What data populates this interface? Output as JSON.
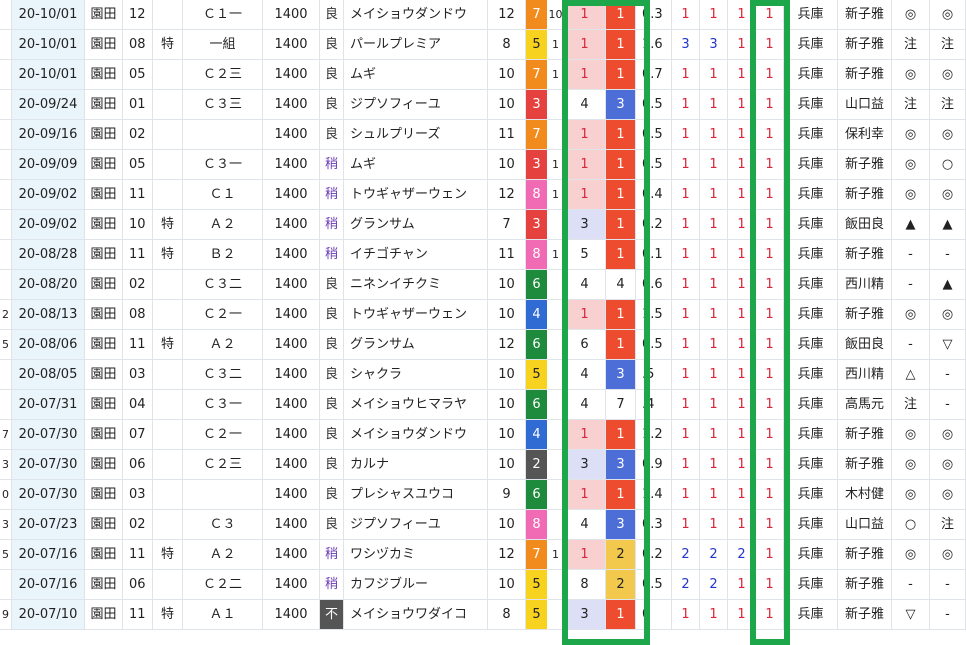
{
  "colors": {
    "frame_green": "#1ea64b",
    "rank_light_pink": "#f9d0d0",
    "rank_red": "#ee4c2f",
    "rank_blue": "#4c6ed6",
    "rank_lavender": "#dcdff5",
    "rank_gold": "#f2c94c",
    "text_red": "#d8263a",
    "text_blue": "#2336c8"
  },
  "gate_colors": {
    "1": "#ffffff",
    "2": "#555555",
    "3": "#e5423f",
    "4": "#2f6bd3",
    "5": "#f7d21e",
    "6": "#1d8a3c",
    "7": "#f28b1e",
    "8": "#f06bb4"
  },
  "rows": [
    {
      "date": "20-10/01",
      "track": "園田",
      "race": "12",
      "special": "",
      "cls": "Ｃ１一",
      "dist": "1400",
      "weather": "良",
      "weather_type": "norm",
      "horse": "メイショウダンドウ",
      "field": "12",
      "gate": "7",
      "h": "10",
      "p1": "1",
      "p2": "1",
      "t": "0.3",
      "c1": "1",
      "c2": "1",
      "c3": "1",
      "fin": "1",
      "loc": "兵庫",
      "jockey": "新子雅",
      "m1": "◎",
      "m2": "◎",
      "lead": ""
    },
    {
      "date": "20-10/01",
      "track": "園田",
      "race": "08",
      "special": "特",
      "cls": "一組",
      "dist": "1400",
      "weather": "良",
      "weather_type": "norm",
      "horse": "パールプレミア",
      "field": "8",
      "gate": "5",
      "h": "1",
      "p1": "1",
      "p2": "1",
      "t": "1.6",
      "c1": "3",
      "c2": "3",
      "c3": "1",
      "fin": "1",
      "loc": "兵庫",
      "jockey": "新子雅",
      "m1": "注",
      "m2": "注",
      "lead": ""
    },
    {
      "date": "20-10/01",
      "track": "園田",
      "race": "05",
      "special": "",
      "cls": "Ｃ２三",
      "dist": "1400",
      "weather": "良",
      "weather_type": "norm",
      "horse": "ムギ",
      "field": "10",
      "gate": "7",
      "h": "1",
      "p1": "1",
      "p2": "1",
      "t": "0.7",
      "c1": "1",
      "c2": "1",
      "c3": "1",
      "fin": "1",
      "loc": "兵庫",
      "jockey": "新子雅",
      "m1": "◎",
      "m2": "◎",
      "lead": ""
    },
    {
      "date": "20-09/24",
      "track": "園田",
      "race": "01",
      "special": "",
      "cls": "Ｃ３三",
      "dist": "1400",
      "weather": "良",
      "weather_type": "norm",
      "horse": "ジプソフィーユ",
      "field": "10",
      "gate": "3",
      "h": "",
      "p1": "4",
      "p2": "3",
      "t": "0.5",
      "c1": "1",
      "c2": "1",
      "c3": "1",
      "fin": "1",
      "loc": "兵庫",
      "jockey": "山口益",
      "m1": "注",
      "m2": "注",
      "lead": ""
    },
    {
      "date": "20-09/16",
      "track": "園田",
      "race": "02",
      "special": "",
      "cls": "",
      "dist": "1400",
      "weather": "良",
      "weather_type": "norm",
      "horse": "シュルプリーズ",
      "field": "11",
      "gate": "7",
      "h": "",
      "p1": "1",
      "p2": "1",
      "t": "0.5",
      "c1": "1",
      "c2": "1",
      "c3": "1",
      "fin": "1",
      "loc": "兵庫",
      "jockey": "保利幸",
      "m1": "◎",
      "m2": "◎",
      "lead": ""
    },
    {
      "date": "20-09/09",
      "track": "園田",
      "race": "05",
      "special": "",
      "cls": "Ｃ３一",
      "dist": "1400",
      "weather": "稍",
      "weather_type": "soft",
      "horse": "ムギ",
      "field": "10",
      "gate": "3",
      "h": "1",
      "p1": "1",
      "p2": "1",
      "t": "0.5",
      "c1": "1",
      "c2": "1",
      "c3": "1",
      "fin": "1",
      "loc": "兵庫",
      "jockey": "新子雅",
      "m1": "◎",
      "m2": "○",
      "lead": ""
    },
    {
      "date": "20-09/02",
      "track": "園田",
      "race": "11",
      "special": "",
      "cls": "Ｃ１",
      "dist": "1400",
      "weather": "稍",
      "weather_type": "soft",
      "horse": "トウギャザーウェン",
      "field": "12",
      "gate": "8",
      "h": "1",
      "p1": "1",
      "p2": "1",
      "t": "0.4",
      "c1": "1",
      "c2": "1",
      "c3": "1",
      "fin": "1",
      "loc": "兵庫",
      "jockey": "新子雅",
      "m1": "◎",
      "m2": "◎",
      "lead": ""
    },
    {
      "date": "20-09/02",
      "track": "園田",
      "race": "10",
      "special": "特",
      "cls": "Ａ２",
      "dist": "1400",
      "weather": "稍",
      "weather_type": "soft",
      "horse": "グランサム",
      "field": "7",
      "gate": "3",
      "h": "",
      "p1": "3",
      "p2": "1",
      "t": "0.2",
      "c1": "1",
      "c2": "1",
      "c3": "1",
      "fin": "1",
      "loc": "兵庫",
      "jockey": "飯田良",
      "m1": "▲",
      "m2": "▲",
      "lead": ""
    },
    {
      "date": "20-08/28",
      "track": "園田",
      "race": "11",
      "special": "特",
      "cls": "Ｂ２",
      "dist": "1400",
      "weather": "稍",
      "weather_type": "soft",
      "horse": "イチゴチャン",
      "field": "11",
      "gate": "8",
      "h": "1",
      "p1": "5",
      "p2": "1",
      "t": "0.1",
      "c1": "1",
      "c2": "1",
      "c3": "1",
      "fin": "1",
      "loc": "兵庫",
      "jockey": "新子雅",
      "m1": "-",
      "m2": "-",
      "lead": ""
    },
    {
      "date": "20-08/20",
      "track": "園田",
      "race": "02",
      "special": "",
      "cls": "Ｃ３二",
      "dist": "1400",
      "weather": "良",
      "weather_type": "norm",
      "horse": "ニネンイチクミ",
      "field": "10",
      "gate": "6",
      "h": "",
      "p1": "4",
      "p2": "4",
      "t": "0.6",
      "c1": "1",
      "c2": "1",
      "c3": "1",
      "fin": "1",
      "loc": "兵庫",
      "jockey": "西川精",
      "m1": "-",
      "m2": "▲",
      "lead": ""
    },
    {
      "date": "20-08/13",
      "track": "園田",
      "race": "08",
      "special": "",
      "cls": "Ｃ２一",
      "dist": "1400",
      "weather": "良",
      "weather_type": "norm",
      "horse": "トウギャザーウェン",
      "field": "10",
      "gate": "4",
      "h": "",
      "p1": "1",
      "p2": "1",
      "t": "1.5",
      "c1": "1",
      "c2": "1",
      "c3": "1",
      "fin": "1",
      "loc": "兵庫",
      "jockey": "新子雅",
      "m1": "◎",
      "m2": "◎",
      "lead": "2"
    },
    {
      "date": "20-08/06",
      "track": "園田",
      "race": "11",
      "special": "特",
      "cls": "Ａ２",
      "dist": "1400",
      "weather": "良",
      "weather_type": "norm",
      "horse": "グランサム",
      "field": "12",
      "gate": "6",
      "h": "",
      "p1": "6",
      "p2": "1",
      "t": "0.5",
      "c1": "1",
      "c2": "1",
      "c3": "1",
      "fin": "1",
      "loc": "兵庫",
      "jockey": "飯田良",
      "m1": "-",
      "m2": "▽",
      "lead": "5"
    },
    {
      "date": "20-08/05",
      "track": "園田",
      "race": "03",
      "special": "",
      "cls": "Ｃ３二",
      "dist": "1400",
      "weather": "良",
      "weather_type": "norm",
      "horse": "シャクラ",
      "field": "10",
      "gate": "5",
      "h": "",
      "p1": "4",
      "p2": "3",
      "t": ".5",
      "c1": "1",
      "c2": "1",
      "c3": "1",
      "fin": "1",
      "loc": "兵庫",
      "jockey": "西川精",
      "m1": "△",
      "m2": "-",
      "lead": ""
    },
    {
      "date": "20-07/31",
      "track": "園田",
      "race": "04",
      "special": "",
      "cls": "Ｃ３一",
      "dist": "1400",
      "weather": "良",
      "weather_type": "norm",
      "horse": "メイショウヒマラヤ",
      "field": "10",
      "gate": "6",
      "h": "",
      "p1": "4",
      "p2": "7",
      "t": ".4",
      "c1": "1",
      "c2": "1",
      "c3": "1",
      "fin": "1",
      "loc": "兵庫",
      "jockey": "高馬元",
      "m1": "注",
      "m2": "-",
      "lead": ""
    },
    {
      "date": "20-07/30",
      "track": "園田",
      "race": "07",
      "special": "",
      "cls": "Ｃ２一",
      "dist": "1400",
      "weather": "良",
      "weather_type": "norm",
      "horse": "メイショウダンドウ",
      "field": "10",
      "gate": "4",
      "h": "",
      "p1": "1",
      "p2": "1",
      "t": "1.2",
      "c1": "1",
      "c2": "1",
      "c3": "1",
      "fin": "1",
      "loc": "兵庫",
      "jockey": "新子雅",
      "m1": "◎",
      "m2": "◎",
      "lead": "7"
    },
    {
      "date": "20-07/30",
      "track": "園田",
      "race": "06",
      "special": "",
      "cls": "Ｃ２三",
      "dist": "1400",
      "weather": "良",
      "weather_type": "norm",
      "horse": "カルナ",
      "field": "10",
      "gate": "2",
      "h": "",
      "p1": "3",
      "p2": "3",
      "t": "0.9",
      "c1": "1",
      "c2": "1",
      "c3": "1",
      "fin": "1",
      "loc": "兵庫",
      "jockey": "新子雅",
      "m1": "◎",
      "m2": "◎",
      "lead": "3"
    },
    {
      "date": "20-07/30",
      "track": "園田",
      "race": "03",
      "special": "",
      "cls": "",
      "dist": "1400",
      "weather": "良",
      "weather_type": "norm",
      "horse": "プレシャスユウコ",
      "field": "9",
      "gate": "6",
      "h": "",
      "p1": "1",
      "p2": "1",
      "t": "1.4",
      "c1": "1",
      "c2": "1",
      "c3": "1",
      "fin": "1",
      "loc": "兵庫",
      "jockey": "木村健",
      "m1": "◎",
      "m2": "◎",
      "lead": "0"
    },
    {
      "date": "20-07/23",
      "track": "園田",
      "race": "02",
      "special": "",
      "cls": "Ｃ３",
      "dist": "1400",
      "weather": "良",
      "weather_type": "norm",
      "horse": "ジプソフィーユ",
      "field": "10",
      "gate": "8",
      "h": "",
      "p1": "4",
      "p2": "3",
      "t": "0.3",
      "c1": "1",
      "c2": "1",
      "c3": "1",
      "fin": "1",
      "loc": "兵庫",
      "jockey": "山口益",
      "m1": "○",
      "m2": "注",
      "lead": "3"
    },
    {
      "date": "20-07/16",
      "track": "園田",
      "race": "11",
      "special": "特",
      "cls": "Ａ２",
      "dist": "1400",
      "weather": "稍",
      "weather_type": "soft",
      "horse": "ワシヅカミ",
      "field": "12",
      "gate": "7",
      "h": "1",
      "p1": "1",
      "p2": "2",
      "t": "0.2",
      "c1": "2",
      "c2": "2",
      "c3": "2",
      "fin": "1",
      "loc": "兵庫",
      "jockey": "新子雅",
      "m1": "◎",
      "m2": "◎",
      "lead": "5"
    },
    {
      "date": "20-07/16",
      "track": "園田",
      "race": "06",
      "special": "",
      "cls": "Ｃ２二",
      "dist": "1400",
      "weather": "稍",
      "weather_type": "soft",
      "horse": "カフジブルー",
      "field": "10",
      "gate": "5",
      "h": "",
      "p1": "8",
      "p2": "2",
      "t": "0.5",
      "c1": "2",
      "c2": "2",
      "c3": "1",
      "fin": "1",
      "loc": "兵庫",
      "jockey": "新子雅",
      "m1": "-",
      "m2": "-",
      "lead": ""
    },
    {
      "date": "20-07/10",
      "track": "園田",
      "race": "11",
      "special": "特",
      "cls": "Ａ１",
      "dist": "1400",
      "weather": "不",
      "weather_type": "heavy",
      "horse": "メイショウワダイコ",
      "field": "8",
      "gate": "5",
      "h": "",
      "p1": "3",
      "p2": "1",
      "t": "0",
      "c1": "1",
      "c2": "1",
      "c3": "1",
      "fin": "1",
      "loc": "兵庫",
      "jockey": "新子雅",
      "m1": "▽",
      "m2": "-",
      "lead": "9"
    }
  ]
}
